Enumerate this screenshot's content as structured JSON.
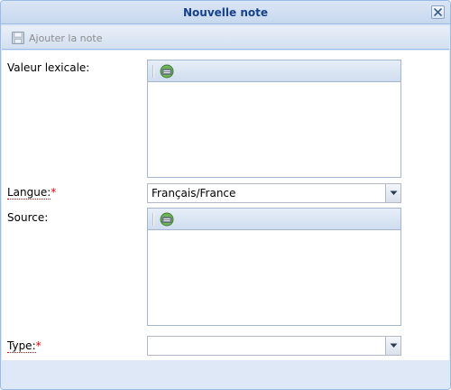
{
  "window": {
    "title": "Nouvelle note"
  },
  "toolbar": {
    "add_note_label": "Ajouter la note"
  },
  "form": {
    "lexical_value": {
      "label": "Valeur lexicale:",
      "value": ""
    },
    "language": {
      "label": "Langue:",
      "required_marker": "*",
      "value": "Français/France"
    },
    "source": {
      "label": "Source:",
      "value": ""
    },
    "type": {
      "label": "Type:",
      "required_marker": "*",
      "value": ""
    }
  },
  "colors": {
    "title_text": "#15428b",
    "window_border": "#99bbe8",
    "window_bg": "#dfe8f6",
    "required_marker": "#ee0000",
    "disabled_text": "#8c8c8c"
  },
  "icons": {
    "close": "close-icon",
    "save": "floppy-disk-icon",
    "editor_button": "edit-html-icon",
    "combo_trigger": "chevron-down-icon"
  }
}
